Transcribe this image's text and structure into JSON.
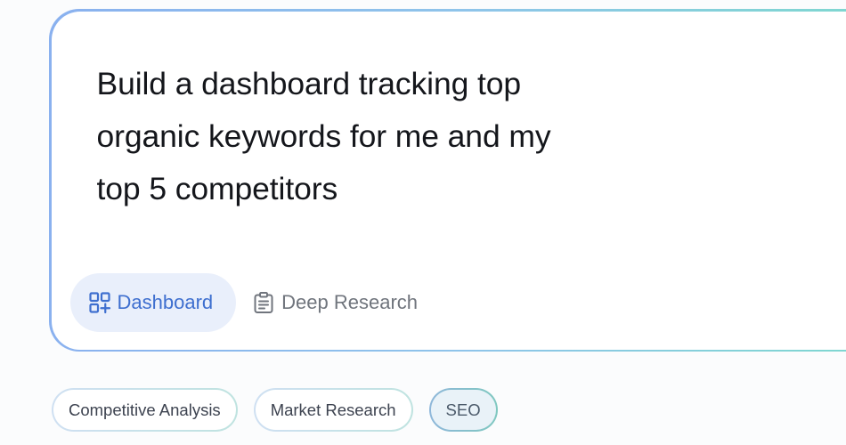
{
  "prompt": {
    "text": "Build a dashboard tracking top\norganic keywords for me and my\ntop 5 competitors"
  },
  "modes": [
    {
      "label": "Dashboard",
      "icon": "dashboard-add-icon",
      "active": true
    },
    {
      "label": "Deep Research",
      "icon": "clipboard-icon",
      "active": false
    }
  ],
  "tags": [
    {
      "label": "Competitive Analysis",
      "selected": false
    },
    {
      "label": "Market Research",
      "selected": false
    },
    {
      "label": "SEO",
      "selected": true
    }
  ],
  "colors": {
    "accent_blue": "#3e6fcf",
    "active_mode_bg": "#e9effb",
    "card_border_start": "#8ab1ef",
    "card_border_end": "#7ed8cf"
  }
}
